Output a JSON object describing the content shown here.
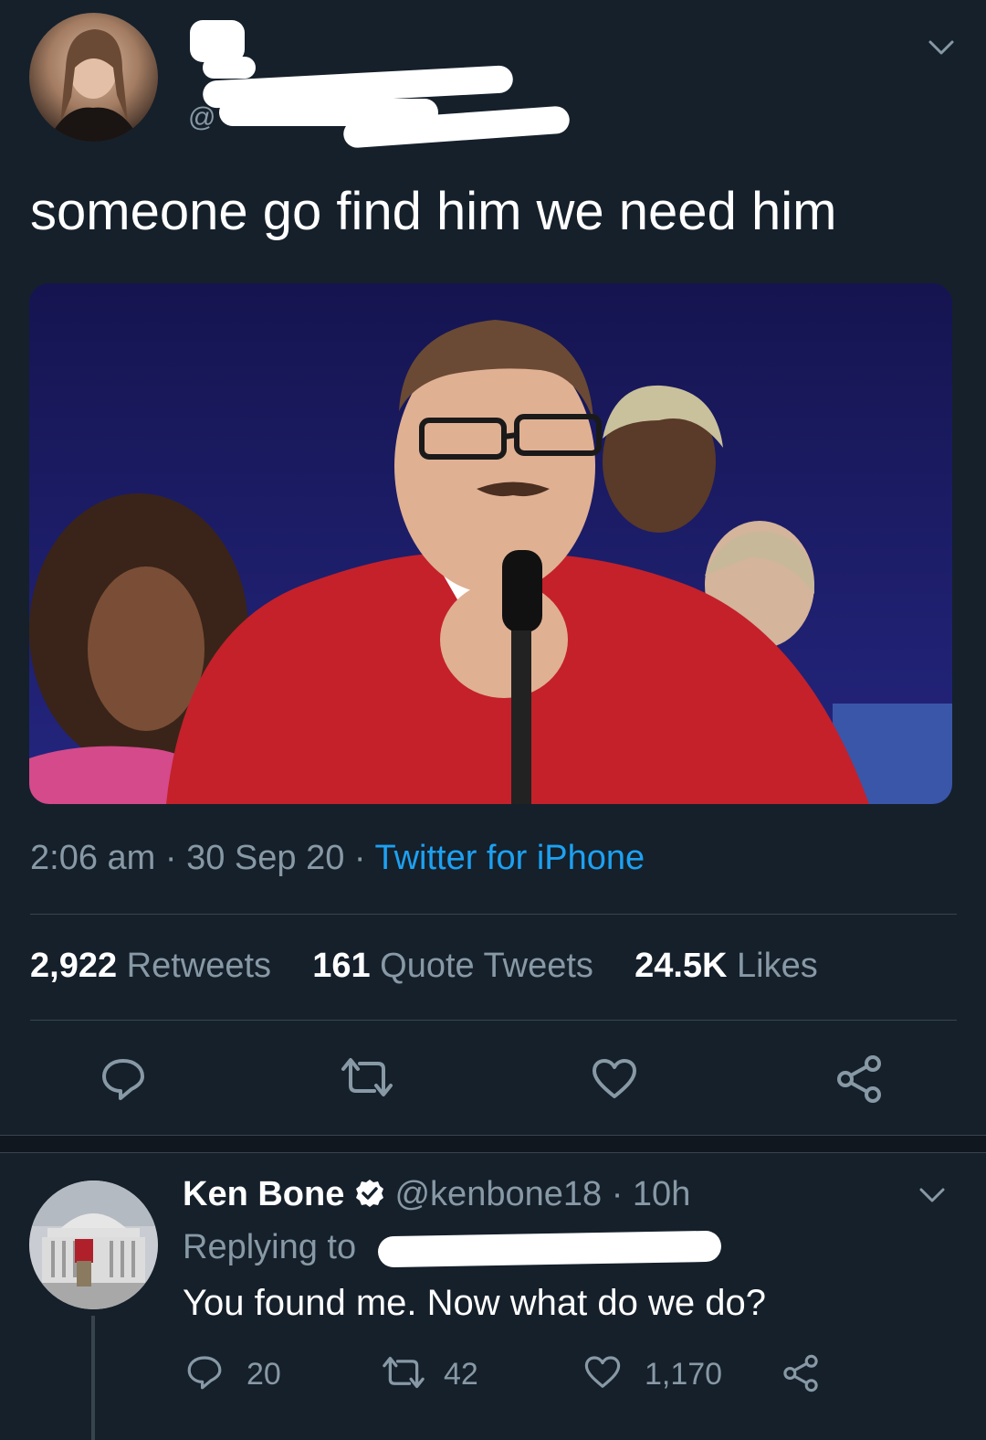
{
  "main_tweet": {
    "handle_prefix": "@",
    "text": "someone go find him we need him",
    "meta": {
      "time": "2:06 am",
      "date": "30 Sep 20",
      "source": "Twitter for iPhone",
      "sep": "·"
    },
    "stats": {
      "retweets_count": "2,922",
      "retweets_label": "Retweets",
      "quotes_count": "161",
      "quotes_label": "Quote Tweets",
      "likes_count": "24.5K",
      "likes_label": "Likes"
    }
  },
  "reply": {
    "name": "Ken Bone",
    "handle": "@kenbone18",
    "sep": "·",
    "age": "10h",
    "replying_to_label": "Replying to",
    "text": "You found me. Now what do we do?",
    "counts": {
      "replies": "20",
      "retweets": "42",
      "likes": "1,170"
    }
  },
  "colors": {
    "background": "#15202b",
    "muted": "#8899a6",
    "link": "#1da1f2",
    "divider": "#38444d"
  }
}
